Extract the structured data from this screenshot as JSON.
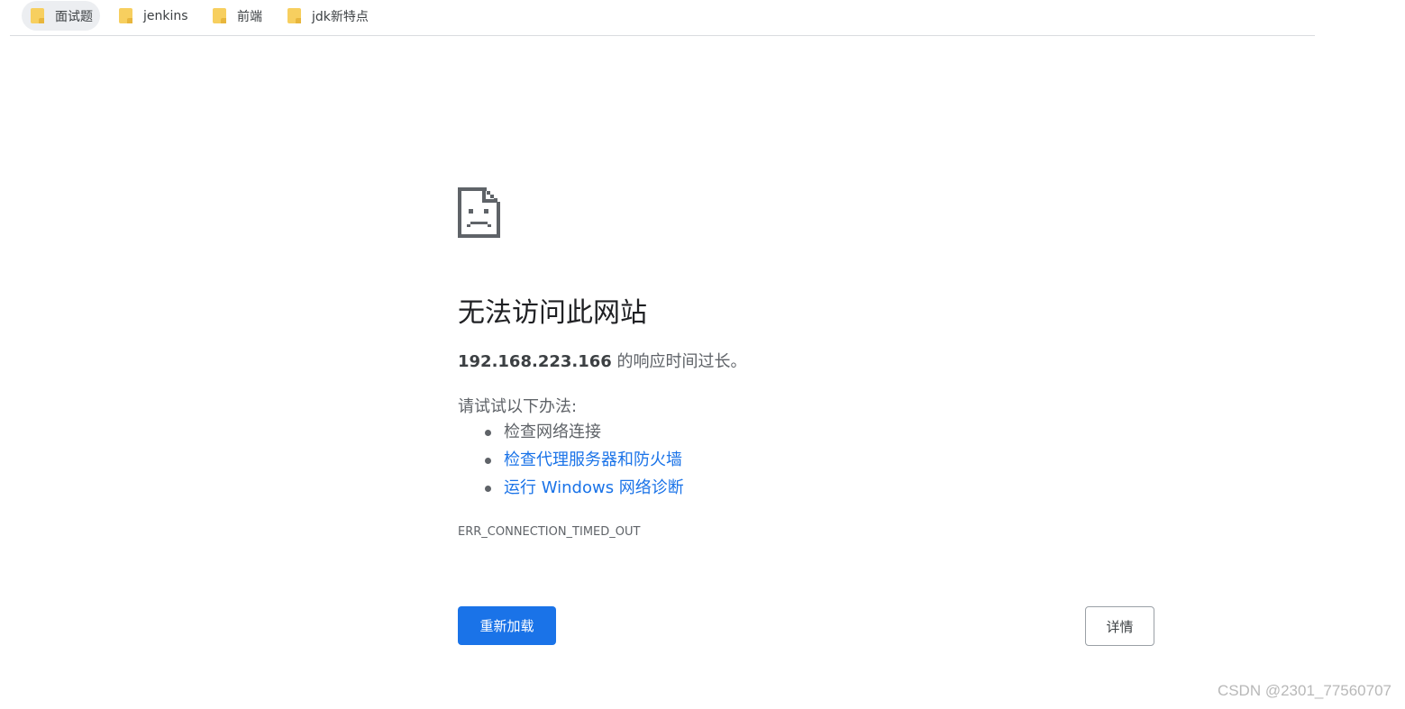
{
  "bookmarks": [
    {
      "label": "面试题",
      "icon": "folder-icon"
    },
    {
      "label": "jenkins",
      "icon": "folder-icon"
    },
    {
      "label": "前端",
      "icon": "folder-icon"
    },
    {
      "label": "jdk新特点",
      "icon": "folder-icon"
    }
  ],
  "error_page": {
    "icon": "sad-page-icon",
    "title": "无法访问此网站",
    "host": "192.168.223.166",
    "message_suffix": " 的响应时间过长。",
    "try_label": "请试试以下办法:",
    "suggestions": [
      {
        "text": "检查网络连接",
        "is_link": false
      },
      {
        "text": "检查代理服务器和防火墙",
        "is_link": true
      },
      {
        "text": "运行 Windows 网络诊断",
        "is_link": true
      }
    ],
    "error_code": "ERR_CONNECTION_TIMED_OUT",
    "reload_label": "重新加载",
    "details_label": "详情"
  },
  "watermark": "CSDN @2301_77560707",
  "colors": {
    "accent": "#1a73e8",
    "text_secondary": "#5f6368",
    "folder": "#f7cf5f"
  }
}
